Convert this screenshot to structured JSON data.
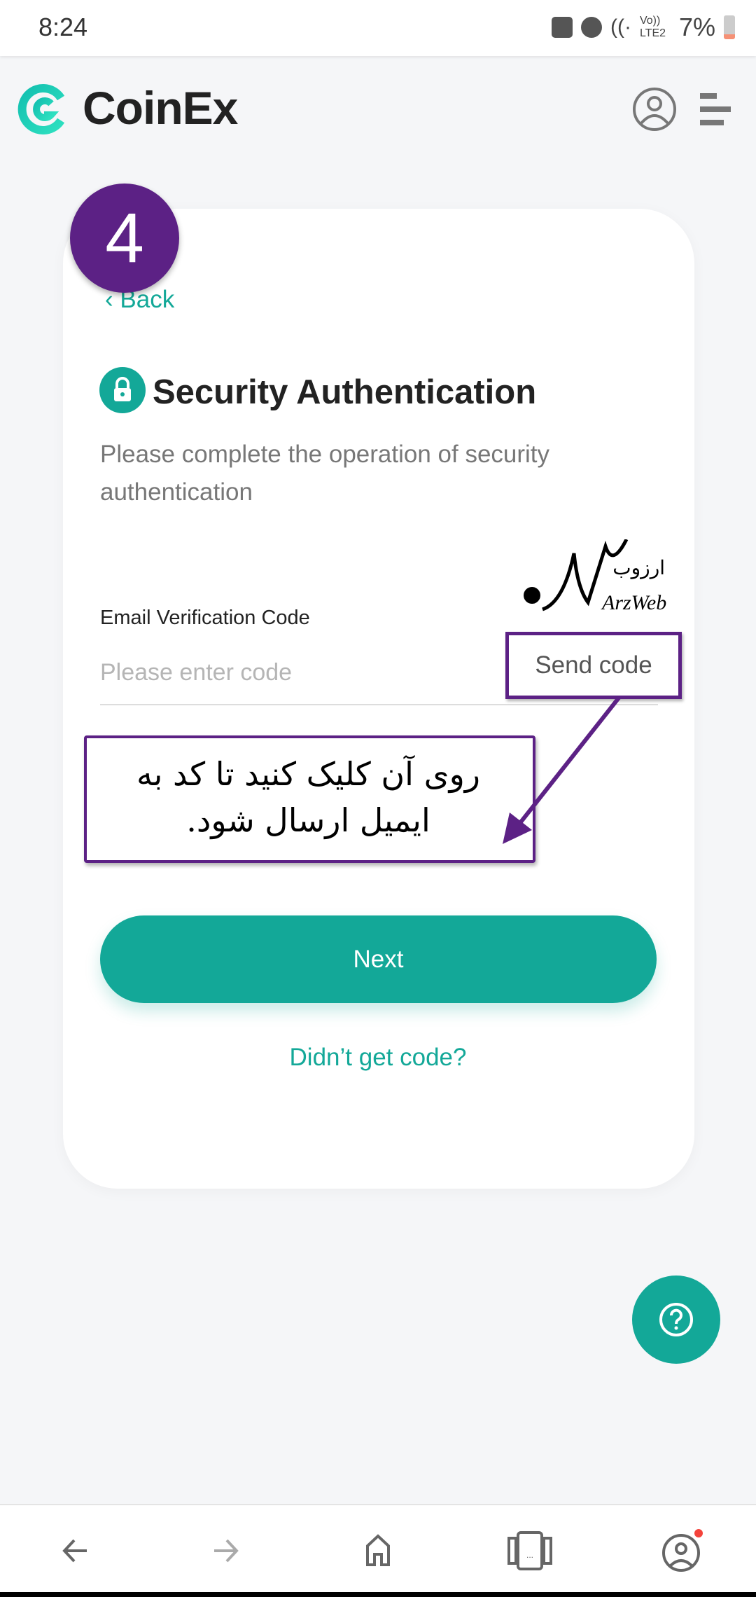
{
  "status_bar": {
    "time": "8:24",
    "network": "Vo)) LTE2",
    "battery": "7%"
  },
  "header": {
    "brand": "CoinEx",
    "icons": [
      "coinex-logo-icon",
      "profile-icon",
      "menu-icon"
    ]
  },
  "step_badge": "4",
  "card": {
    "back_label": "Back",
    "title": "Security Authentication",
    "subtitle": "Please complete the operation of security authentication",
    "field_label": "Email Verification Code",
    "field_value": "",
    "field_placeholder": "Please enter code",
    "send_code": "Send code",
    "next": "Next",
    "didnt_get": "Didn’t get code?"
  },
  "annotation": {
    "text": "روی آن کلیک کنید تا کد به ایمیل ارسال شود.",
    "watermark": "ارزوب ArzWeb"
  },
  "colors": {
    "accent": "#13a898",
    "annotation": "#5c2185"
  },
  "bottom_nav": [
    "back-icon",
    "forward-icon",
    "home-icon",
    "tabs-icon",
    "account-icon"
  ]
}
